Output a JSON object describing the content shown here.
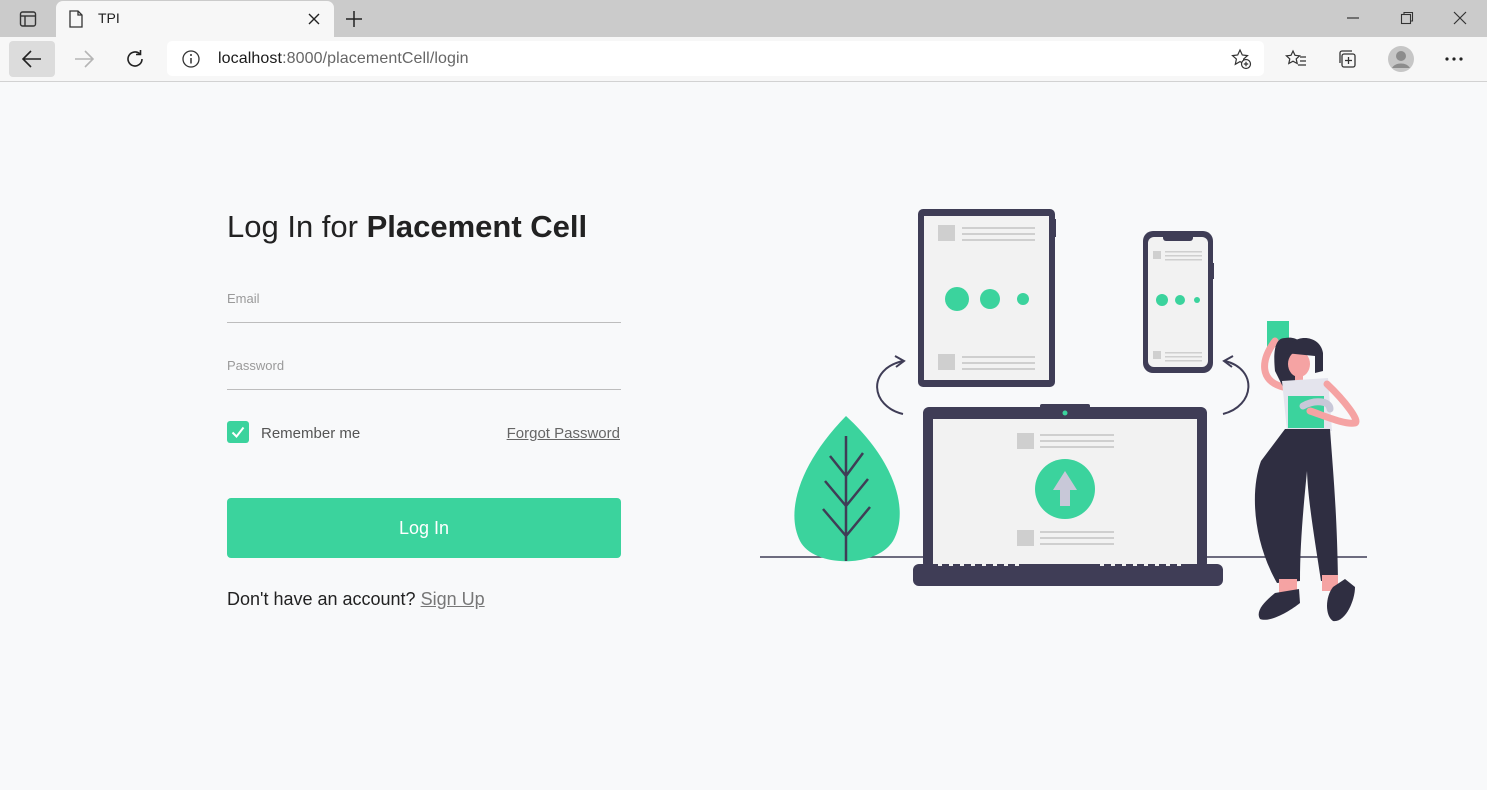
{
  "browser": {
    "tab": {
      "title": "TPI"
    },
    "address": {
      "host": "localhost",
      "rest": ":8000/placementCell/login"
    }
  },
  "login": {
    "title_plain": "Log In for ",
    "title_bold": "Placement Cell",
    "email_placeholder": "Email",
    "password_placeholder": "Password",
    "remember_label": "Remember me",
    "remember_checked": true,
    "forgot_label": "Forgot Password",
    "submit_label": "Log In",
    "signup_prompt": "Don't have an account?",
    "signup_link": "Sign Up"
  },
  "colors": {
    "accent": "#3bd39d",
    "dark": "#3f3d56"
  }
}
